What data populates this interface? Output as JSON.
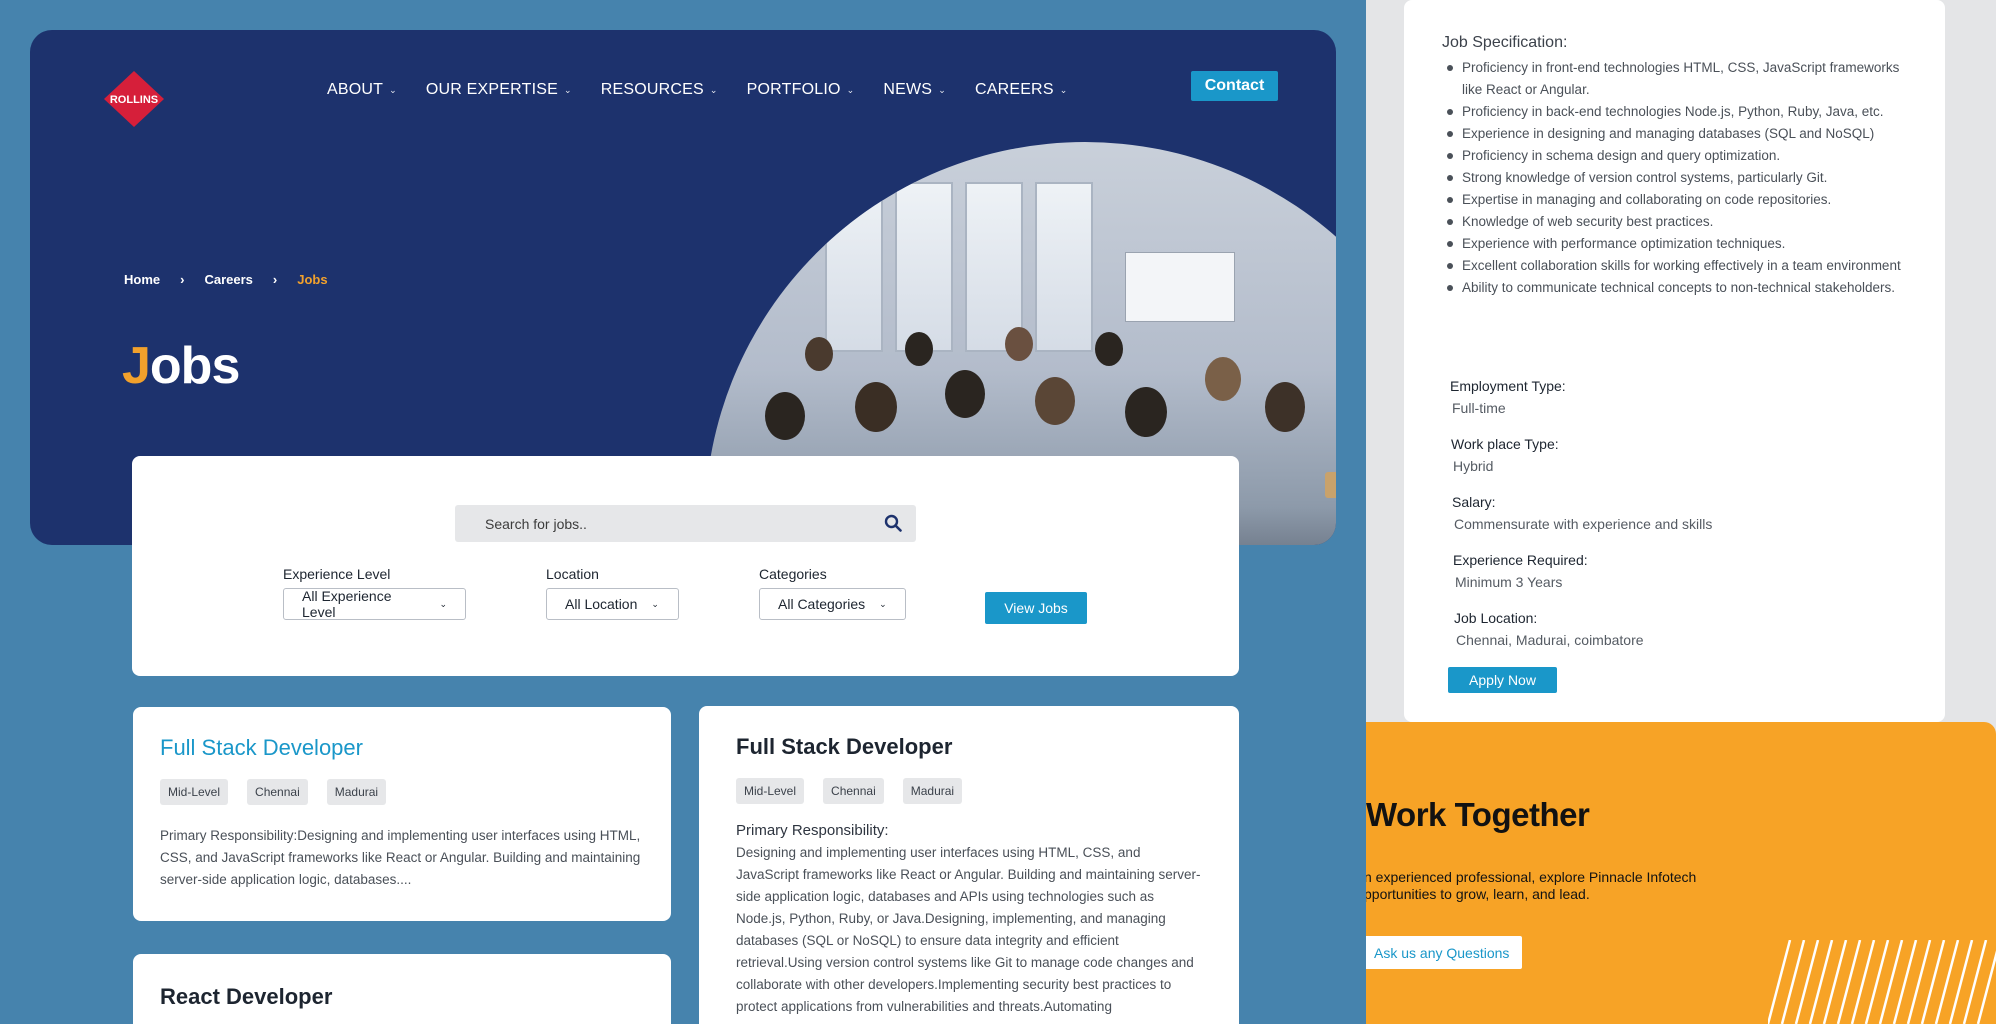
{
  "brand": {
    "logo_text": "ROLLINS",
    "logo_color": "#d61f3a"
  },
  "nav": {
    "items": [
      {
        "label": "ABOUT"
      },
      {
        "label": "OUR EXPERTISE"
      },
      {
        "label": "RESOURCES"
      },
      {
        "label": "PORTFOLIO"
      },
      {
        "label": "NEWS"
      },
      {
        "label": "CAREERS"
      }
    ],
    "contact_label": "Contact"
  },
  "breadcrumb": {
    "home": "Home",
    "careers": "Careers",
    "current": "Jobs",
    "separator": "›"
  },
  "hero": {
    "title_first": "J",
    "title_rest": "obs"
  },
  "search": {
    "placeholder": "Search for jobs..",
    "filters": {
      "experience": {
        "label": "Experience Level",
        "selected": "All Experience Level"
      },
      "location": {
        "label": "Location",
        "selected": "All Location"
      },
      "categories": {
        "label": "Categories",
        "selected": "All Categories"
      }
    },
    "view_jobs_label": "View Jobs"
  },
  "jobs": [
    {
      "title": "Full Stack Developer",
      "tags": [
        "Mid-Level",
        "Chennai",
        "Madurai"
      ],
      "excerpt": "Primary Responsibility:Designing and implementing user interfaces using HTML, CSS, and JavaScript frameworks like React or Angular. Building and maintaining server-side application logic, databases...."
    },
    {
      "title": "React Developer"
    }
  ],
  "job_detail": {
    "title": "Full Stack Developer",
    "tags": [
      "Mid-Level",
      "Chennai",
      "Madurai"
    ],
    "responsibility_heading": "Primary Responsibility:",
    "responsibility_text": "Designing and implementing user interfaces using HTML, CSS, and JavaScript frameworks like React or Angular. Building and maintaining server-side application logic, databases and APIs using technologies such as Node.js, Python, Ruby, or Java.Designing, implementing, and managing databases (SQL or NoSQL) to ensure data integrity and efficient retrieval.Using version control systems like Git to manage code changes and collaborate with other developers.Implementing security best practices to protect applications from vulnerabilities and threats.Automating"
  },
  "spec": {
    "title": "Job Specification:",
    "items": [
      "Proficiency in front-end technologies HTML, CSS, JavaScript frameworks like React or Angular.",
      "Proficiency in back-end technologies Node.js, Python, Ruby, Java, etc.",
      "Experience in designing and managing databases (SQL and NoSQL)",
      "Proficiency in schema design and query optimization.",
      "Strong knowledge of version control systems, particularly Git.",
      "Expertise in managing and collaborating on code repositories.",
      "Knowledge of web security best practices.",
      "Experience with performance optimization techniques.",
      "Excellent collaboration skills for working effectively in a team environment",
      "Ability to communicate technical concepts to non-technical stakeholders."
    ],
    "details": [
      {
        "label": "Employment Type:",
        "value": "Full-time"
      },
      {
        "label": "Work place Type:",
        "value": "Hybrid"
      },
      {
        "label": "Salary:",
        "value": "Commensurate with experience and skills"
      },
      {
        "label": "Experience Required:",
        "value": "Minimum 3 Years"
      },
      {
        "label": "Job Location:",
        "value": "Chennai, Madurai, coimbatore"
      }
    ],
    "apply_label": "Apply Now"
  },
  "cta": {
    "title": "Work Together",
    "text": "n experienced professional, explore Pinnacle Infotech pportunities to grow, learn, and lead.",
    "button_label": "Ask us any Questions"
  },
  "colors": {
    "navy": "#1d326d",
    "page_blue": "#4683ad",
    "accent_orange": "#f2a12c",
    "button_blue": "#1a97c9",
    "cta_orange": "#f7a326"
  }
}
